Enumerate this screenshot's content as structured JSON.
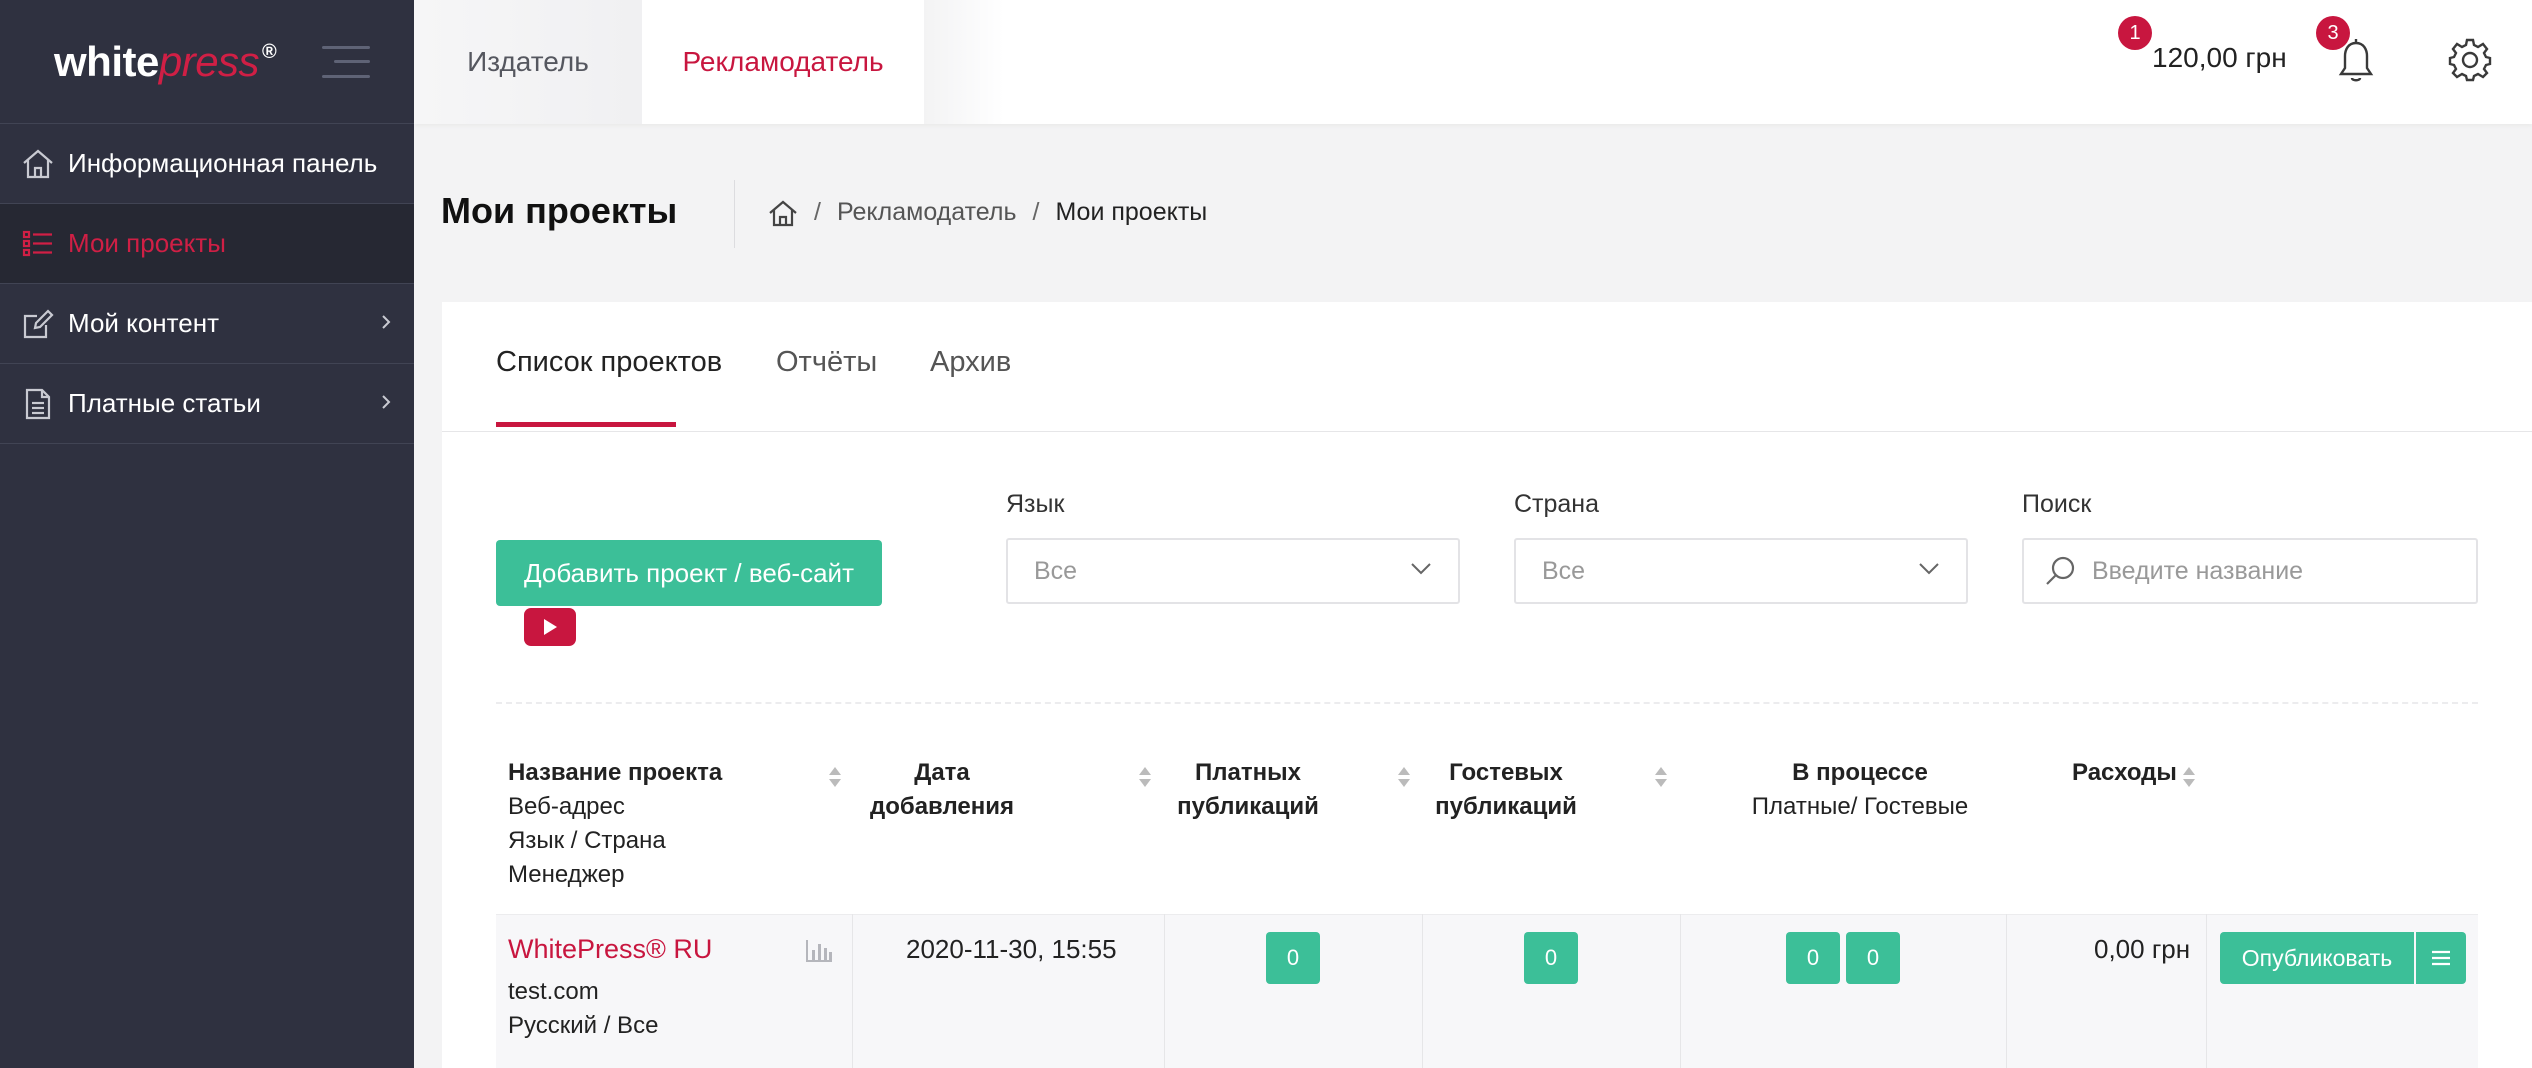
{
  "logo": {
    "white": "white",
    "press": "press",
    "reg": "®"
  },
  "sidebar": {
    "items": [
      {
        "label": "Информационная панель",
        "icon": "home-icon"
      },
      {
        "label": "Мои проекты",
        "icon": "list-icon",
        "active": true
      },
      {
        "label": "Мой контент",
        "icon": "edit-icon"
      },
      {
        "label": "Платные статьи",
        "icon": "document-icon"
      }
    ]
  },
  "topbar": {
    "tabs": [
      {
        "label": "Издатель"
      },
      {
        "label": "Рекламодатель"
      }
    ],
    "balance": "120,00 грн",
    "balance_badge": "1",
    "notifications_badge": "3"
  },
  "page": {
    "title": "Мои проекты",
    "breadcrumb": {
      "level1": "Рекламодатель",
      "current": "Мои проекты",
      "sep": "/"
    }
  },
  "card": {
    "tabs": [
      {
        "label": "Список проектов"
      },
      {
        "label": "Отчёты"
      },
      {
        "label": "Архив"
      }
    ],
    "add_button": "Добавить проект / веб-сайт",
    "filters": {
      "language": {
        "label": "Язык",
        "value": "Все"
      },
      "country": {
        "label": "Страна",
        "value": "Все"
      },
      "search": {
        "label": "Поиск",
        "placeholder": "Введите название"
      }
    }
  },
  "table": {
    "headers": {
      "name": [
        "Название проекта",
        "Веб-адрес",
        "Язык / Страна",
        "Менеджер"
      ],
      "date": [
        "Дата",
        "добавления"
      ],
      "paid": [
        "Платных",
        "публикаций"
      ],
      "guest": [
        "Гостевых",
        "публикаций"
      ],
      "progress": [
        "В процессе",
        "Платные/ Гостевые"
      ],
      "expenses": "Расходы"
    },
    "rows": [
      {
        "name": "WhitePress® RU",
        "url": "test.com",
        "lang_country": "Русский / Все",
        "date": "2020-11-30, 15:55",
        "paid": "0",
        "guest": "0",
        "progress_paid": "0",
        "progress_guest": "0",
        "expenses": "0,00 грн",
        "publish_label": "Опубликовать"
      }
    ]
  },
  "colors": {
    "accent": "#c8163f",
    "green": "#3cbf98",
    "sidebar": "#2f3140"
  }
}
